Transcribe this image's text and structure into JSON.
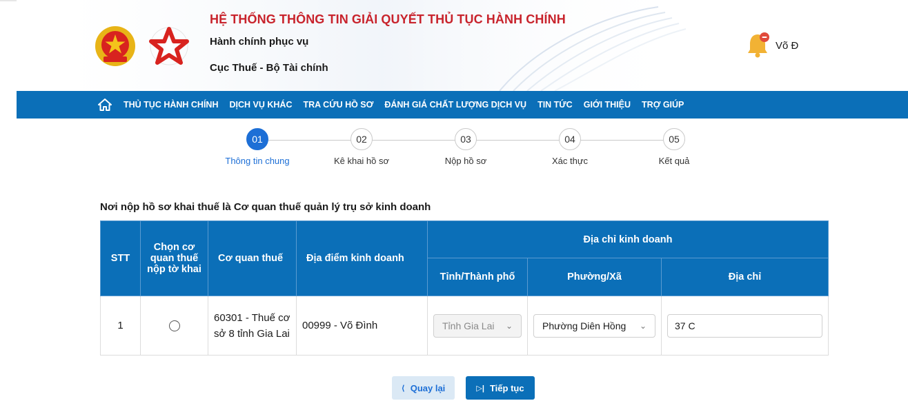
{
  "header": {
    "system_title": "HỆ THỐNG THÔNG TIN GIẢI QUYẾT THỦ TỤC HÀNH CHÍNH",
    "subtitle_1": "Hành chính phục vụ",
    "subtitle_2": "Cục Thuế - Bộ Tài chính",
    "user_name": "Võ Đ",
    "colors": {
      "title_red": "#c8232c",
      "nav_blue": "#0b6fb8"
    }
  },
  "nav": {
    "items": [
      "THỦ TỤC HÀNH CHÍNH",
      "DỊCH VỤ KHÁC",
      "TRA CỨU HỒ SƠ",
      "ĐÁNH GIÁ CHẤT LƯỢNG DỊCH VỤ",
      "TIN TỨC",
      "GIỚI THIỆU",
      "TRỢ GIÚP"
    ]
  },
  "stepper": {
    "active_index": 0,
    "steps": [
      {
        "number": "01",
        "label": "Thông tin chung"
      },
      {
        "number": "02",
        "label": "Kê khai hồ sơ"
      },
      {
        "number": "03",
        "label": "Nộp hồ sơ"
      },
      {
        "number": "04",
        "label": "Xác thực"
      },
      {
        "number": "05",
        "label": "Kết quả"
      }
    ]
  },
  "section_title": "Nơi nộp hồ sơ khai thuế là Cơ quan thuế quản lý trụ sở kinh doanh",
  "table": {
    "headers": {
      "stt": "STT",
      "choose": "Chọn cơ quan thuế nộp tờ khai",
      "tax_office": "Cơ quan thuế",
      "business_location": "Địa điểm kinh doanh",
      "business_address": "Địa chỉ kinh doanh",
      "province": "Tỉnh/Thành phố",
      "ward": "Phường/Xã",
      "address": "Địa chỉ"
    },
    "rows": [
      {
        "stt": "1",
        "selected": false,
        "tax_office": "60301 - Thuế cơ sở 8 tỉnh Gia Lai",
        "business_location": "00999 - Võ Đình",
        "province": "Tỉnh Gia Lai",
        "ward": "Phường Diên Hồng",
        "address": "37 C"
      }
    ]
  },
  "buttons": {
    "back": "Quay lại",
    "next": "Tiếp tục"
  }
}
